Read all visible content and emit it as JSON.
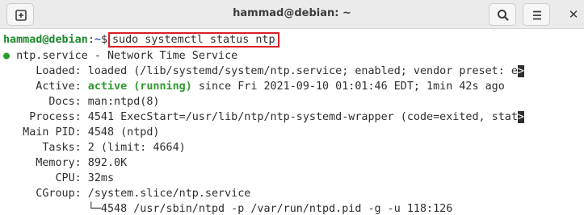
{
  "window": {
    "title": "hammad@debian: ~",
    "new_tab_icon": "new-tab-icon",
    "search_icon": "search-icon",
    "menu_icon": "hamburger-menu-icon",
    "close_label": "✕"
  },
  "terminal": {
    "prompt_user": "hammad@debian",
    "prompt_sep": ":",
    "prompt_path": "~",
    "prompt_sym": "$",
    "command": "sudo systemctl status ntp",
    "service_dot": "●",
    "service_line": " ntp.service - Network Time Service",
    "loaded_label": "     Loaded:",
    "loaded_value": " loaded (/lib/systemd/system/ntp.service; enabled; vendor preset: e",
    "trunc_mark": ">",
    "active_label": "     Active:",
    "active_state": " active (running)",
    "active_rest": " since Fri 2021-09-10 01:01:46 EDT; 1min 42s ago",
    "docs_line": "       Docs: man:ntpd(8)",
    "process_line": "    Process: 4541 ExecStart=/usr/lib/ntp/ntp-systemd-wrapper (code=exited, stat",
    "mainpid_line": "   Main PID: 4548 (ntpd)",
    "tasks_line": "      Tasks: 2 (limit: 4664)",
    "memory_line": "     Memory: 892.0K",
    "cpu_line": "        CPU: 32ms",
    "cgroup_line": "     CGroup: /system.slice/ntp.service",
    "cgroup_child": "             └─4548 /usr/sbin/ntpd -p /var/run/ntpd.pid -g -u 118:126"
  },
  "colors": {
    "prompt_user": "#1f8a2e",
    "prompt_path": "#2f5bb7",
    "active": "#2e9b2e",
    "highlight_box": "#d81f26"
  }
}
